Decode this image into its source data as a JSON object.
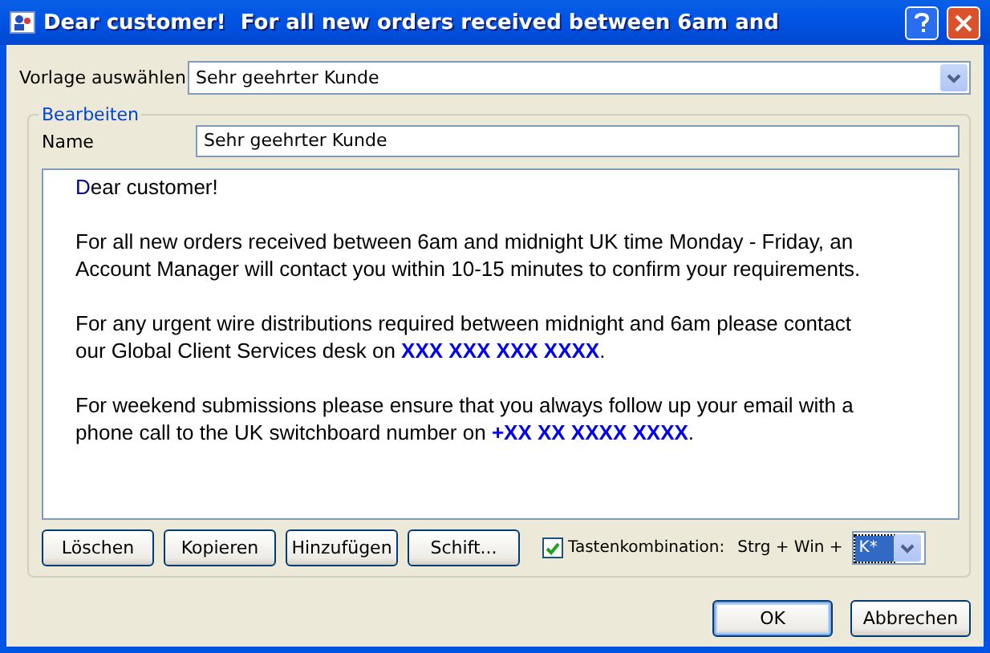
{
  "window": {
    "title": "Dear customer!  For all new orders received between 6am and"
  },
  "template": {
    "label": "Vorlage auswählen",
    "value": "Sehr geehrter Kunde"
  },
  "edit_group": {
    "legend": "Bearbeiten",
    "name_label": "Name",
    "name_value": "Sehr geehrter Kunde",
    "paragraphs": [
      "Dear customer!",
      "For all new orders received between 6am and midnight UK time Monday - Friday, an Account Manager will contact you within 10-15 minutes to confirm your requirements.",
      "For any urgent wire distributions required between midnight and 6am please contact our Global Client Services desk on **XXX XXX XXX XXXX**.",
      "For weekend submissions please ensure that you always follow up your email with a phone call to the UK switchboard number on **+XX XX XXXX XXXX**."
    ],
    "buttons": [
      "Löschen",
      "Kopieren",
      "Hinzufügen",
      "Schift..."
    ],
    "hotkey": {
      "label": "Tastenkombination:",
      "checked": true,
      "prefix": "Strg + Win +",
      "key": "K*"
    }
  },
  "footer_buttons": [
    "OK",
    "Abbrechen"
  ]
}
